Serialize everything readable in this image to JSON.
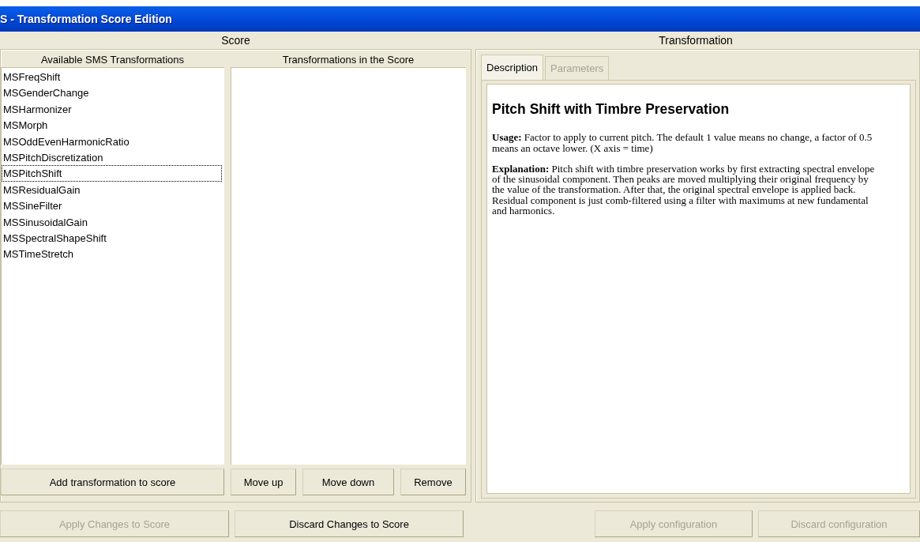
{
  "window": {
    "title": "S - Transformation Score Edition"
  },
  "score": {
    "heading": "Score",
    "available": {
      "heading": "Available SMS Transformations",
      "items": [
        {
          "label": "MSFreqShift",
          "selected": false
        },
        {
          "label": "MSGenderChange",
          "selected": false
        },
        {
          "label": "MSHarmonizer",
          "selected": false
        },
        {
          "label": "MSMorph",
          "selected": false
        },
        {
          "label": "MSOddEvenHarmonicRatio",
          "selected": false
        },
        {
          "label": "MSPitchDiscretization",
          "selected": false
        },
        {
          "label": "MSPitchShift",
          "selected": true
        },
        {
          "label": "MSResidualGain",
          "selected": false
        },
        {
          "label": "MSSineFilter",
          "selected": false
        },
        {
          "label": "MSSinusoidalGain",
          "selected": false
        },
        {
          "label": "MSSpectralShapeShift",
          "selected": false
        },
        {
          "label": "MSTimeStretch",
          "selected": false
        }
      ],
      "button": {
        "label": "Add transformation to score",
        "disabled": false
      }
    },
    "in_score": {
      "heading": "Transformations in the Score",
      "buttons": [
        {
          "label": "Move up",
          "disabled": false
        },
        {
          "label": "Move down",
          "disabled": false
        },
        {
          "label": "Remove",
          "disabled": false
        }
      ]
    },
    "buttons": [
      {
        "label": "Apply Changes to Score",
        "disabled": true
      },
      {
        "label": "Discard Changes to Score",
        "disabled": false
      }
    ]
  },
  "transformation": {
    "heading": "Transformation",
    "tabs": [
      {
        "label": "Description",
        "selected": true,
        "disabled": false
      },
      {
        "label": "Parameters",
        "selected": false,
        "disabled": true
      }
    ],
    "description": {
      "title": "Pitch Shift with Timbre Preservation",
      "paragraphs": [
        "**Usage:** Factor to apply to current pitch. The default 1 value means no change, a factor of 0.5 means an octave lower. (X axis = time)",
        "**Explanation:** Pitch shift with timbre preservation works by first extracting spectral envelope of the sinusoidal component. Then peaks are moved multiplying their original frequency by the value of the transformation. After that, the original spectral envelope is applied back. Residual component is just comb-filtered using a filter with maximums at new fundamental and harmonics."
      ]
    },
    "buttons": [
      {
        "label": "Apply configuration",
        "disabled": true
      },
      {
        "label": "Discard configuration",
        "disabled": true
      }
    ]
  }
}
